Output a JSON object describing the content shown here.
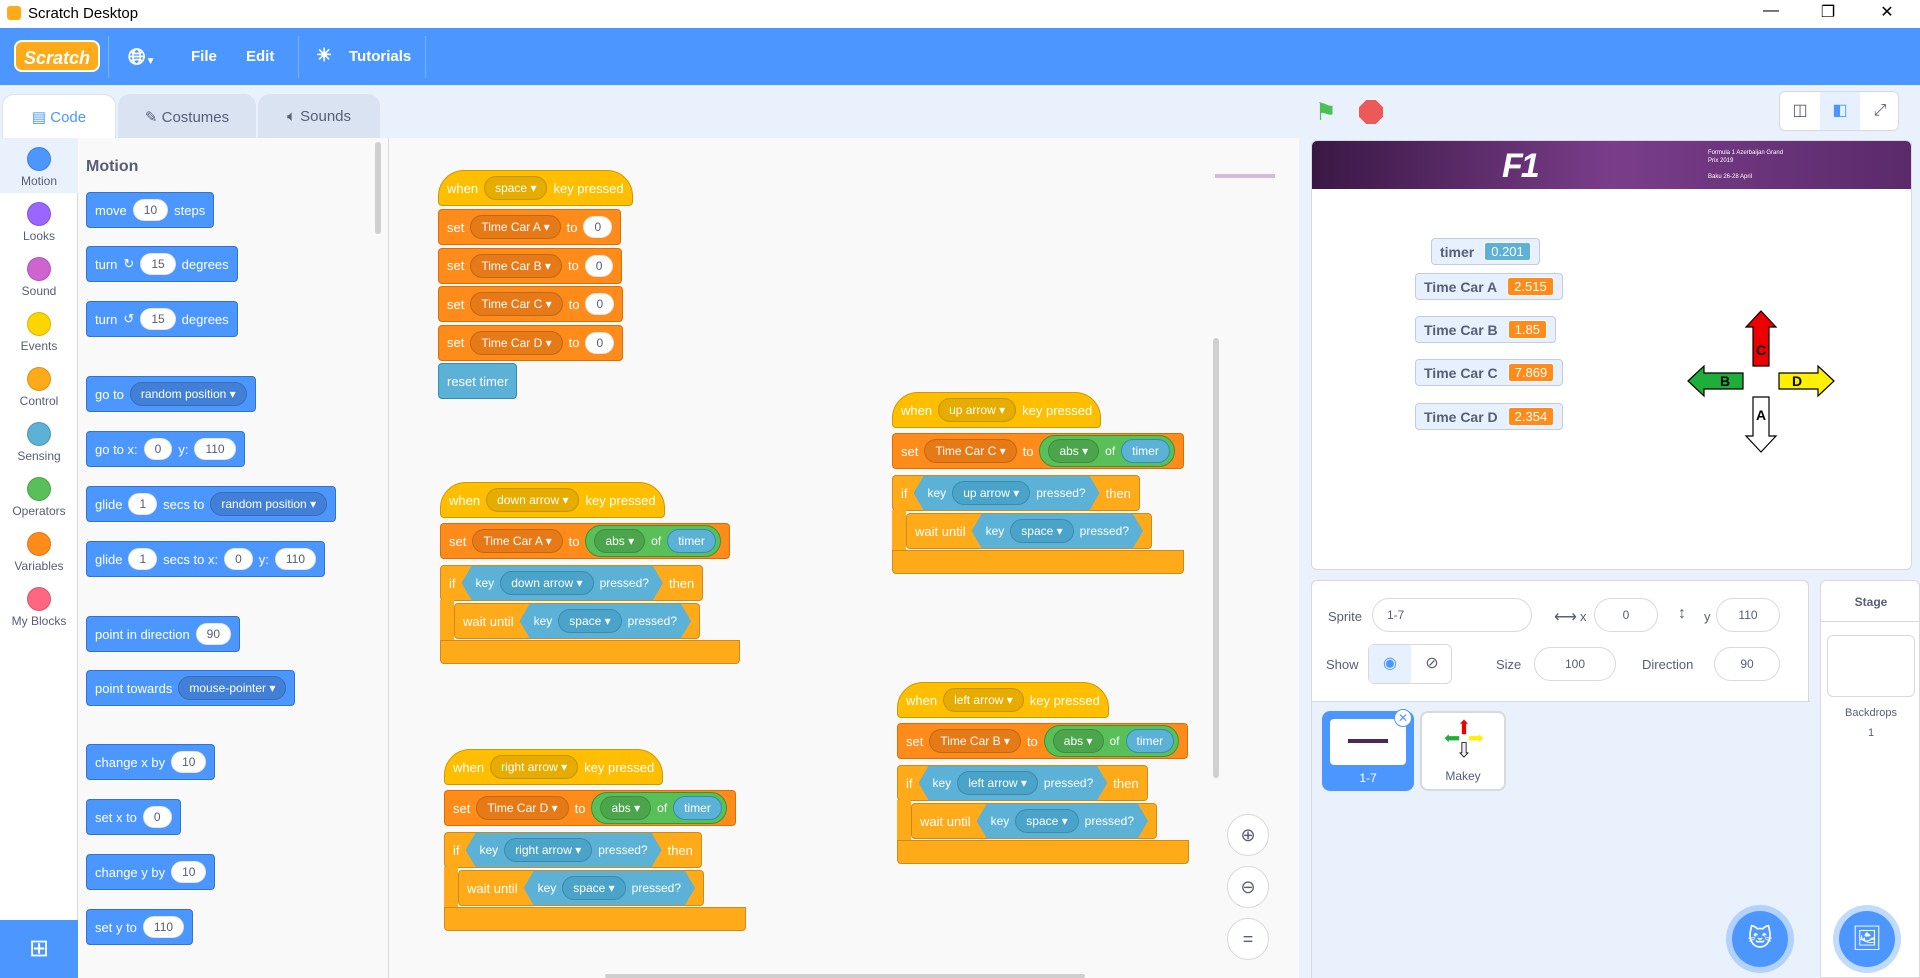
{
  "titlebar": {
    "title": "Scratch Desktop",
    "minimize": "—",
    "maximize": "❐",
    "close": "✕"
  },
  "menubar": {
    "logo": "Scratch",
    "language_icon": "globe-icon",
    "file": "File",
    "edit": "Edit",
    "tutorials": "Tutorials"
  },
  "tabs": {
    "code": "Code",
    "costumes": "Costumes",
    "sounds": "Sounds"
  },
  "categories": [
    {
      "label": "Motion",
      "color": "#4c97ff"
    },
    {
      "label": "Looks",
      "color": "#9966ff"
    },
    {
      "label": "Sound",
      "color": "#cf63cf"
    },
    {
      "label": "Events",
      "color": "#ffd500"
    },
    {
      "label": "Control",
      "color": "#ffab19"
    },
    {
      "label": "Sensing",
      "color": "#5cb1d6"
    },
    {
      "label": "Operators",
      "color": "#59c059"
    },
    {
      "label": "Variables",
      "color": "#ff8c1a"
    },
    {
      "label": "My Blocks",
      "color": "#ff6680"
    }
  ],
  "palette": {
    "heading": "Motion",
    "move": {
      "a": "move",
      "v": "10",
      "b": "steps"
    },
    "turn_right": {
      "a": "turn",
      "v": "15",
      "b": "degrees"
    },
    "turn_left": {
      "a": "turn",
      "v": "15",
      "b": "degrees"
    },
    "goto": {
      "a": "go to",
      "v": "random position"
    },
    "gotoxy": {
      "a": "go to x:",
      "x": "0",
      "b": "y:",
      "y": "110"
    },
    "glide1": {
      "a": "glide",
      "v": "1",
      "b": "secs to",
      "t": "random position"
    },
    "glide2": {
      "a": "glide",
      "v": "1",
      "b": "secs to x:",
      "x": "0",
      "c": "y:",
      "y": "110"
    },
    "pointdir": {
      "a": "point in direction",
      "v": "90"
    },
    "pointtowards": {
      "a": "point towards",
      "v": "mouse-pointer"
    },
    "changex": {
      "a": "change x by",
      "v": "10"
    },
    "setx": {
      "a": "set x to",
      "v": "0"
    },
    "changey": {
      "a": "change y by",
      "v": "10"
    },
    "sety": {
      "a": "set y to",
      "v": "110"
    }
  },
  "scripts": {
    "s1": {
      "when": "when",
      "key": "space",
      "pressed": "key pressed",
      "set": "set",
      "to": "to",
      "vars": [
        "Time Car A",
        "Time Car B",
        "Time Car C",
        "Time Car D"
      ],
      "vals": [
        "0",
        "0",
        "0",
        "0"
      ],
      "reset": "reset timer"
    },
    "s2": {
      "when": "when",
      "key": "down arrow",
      "pressed": "key pressed",
      "set": "set",
      "var": "Time Car A",
      "to": "to",
      "abs": "abs",
      "of": "of",
      "timer": "timer",
      "if": "if",
      "keyword": "key",
      "ifkey": "down arrow",
      "pressedq": "pressed?",
      "then": "then",
      "wait": "wait until",
      "waitkey": "space"
    },
    "s3": {
      "when": "when",
      "key": "right arrow",
      "pressed": "key pressed",
      "set": "set",
      "var": "Time Car D",
      "to": "to",
      "abs": "abs",
      "of": "of",
      "timer": "timer",
      "if": "if",
      "keyword": "key",
      "ifkey": "right arrow",
      "pressedq": "pressed?",
      "then": "then",
      "wait": "wait until",
      "waitkey": "space"
    },
    "s4": {
      "when": "when",
      "key": "up arrow",
      "pressed": "key pressed",
      "set": "set",
      "var": "Time Car C",
      "to": "to",
      "abs": "abs",
      "of": "of",
      "timer": "timer",
      "if": "if",
      "keyword": "key",
      "ifkey": "up arrow",
      "pressedq": "pressed?",
      "then": "then",
      "wait": "wait until",
      "waitkey": "space"
    },
    "s5": {
      "when": "when",
      "key": "left arrow",
      "pressed": "key pressed",
      "set": "set",
      "var": "Time Car B",
      "to": "to",
      "abs": "abs",
      "of": "of",
      "timer": "timer",
      "if": "if",
      "keyword": "key",
      "ifkey": "left arrow",
      "pressedq": "pressed?",
      "then": "then",
      "wait": "wait until",
      "waitkey": "space"
    }
  },
  "stage": {
    "banner": {
      "text": "Formula 1 Azerbaijan Grand Prix 2019",
      "dates": "Baku 26-28 April"
    },
    "monitors": [
      {
        "label": "timer",
        "value": "0.201",
        "color": "#5cb1d6"
      },
      {
        "label": "Time Car A",
        "value": "2.515",
        "color": "#ff8c1a"
      },
      {
        "label": "Time Car B",
        "value": "1.85",
        "color": "#ff8c1a"
      },
      {
        "label": "Time Car C",
        "value": "7.869",
        "color": "#ff8c1a"
      },
      {
        "label": "Time Car D",
        "value": "2.354",
        "color": "#ff8c1a"
      }
    ],
    "arrows": {
      "up": "C",
      "left": "B",
      "right": "D",
      "down": "A"
    }
  },
  "sprite_info": {
    "sprite_label": "Sprite",
    "sprite_name": "1-7",
    "x_label": "x",
    "x": "0",
    "y_label": "y",
    "y": "110",
    "show_label": "Show",
    "size_label": "Size",
    "size": "100",
    "direction_label": "Direction",
    "direction": "90"
  },
  "sprites": [
    {
      "name": "1-7"
    },
    {
      "name": "Makey"
    }
  ],
  "stage_pane": {
    "title": "Stage",
    "backdrops_label": "Backdrops",
    "backdrops_count": "1"
  }
}
